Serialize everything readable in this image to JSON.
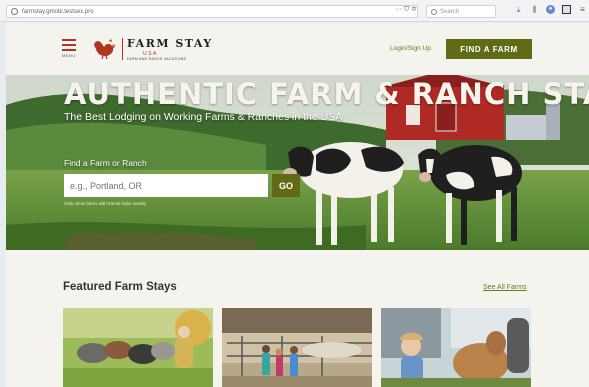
{
  "browser": {
    "url": "farmstay.gmobi.testsex.pro",
    "actions": "··· ⛉ ☆",
    "search_placeholder": "Search",
    "toolbar_icons": [
      "download-icon",
      "library-icon",
      "account-icon",
      "sidebar-icon",
      "overflow-icon"
    ]
  },
  "header": {
    "menu_label": "MENU",
    "logo_title": "FARM STAY",
    "logo_sub": "USA",
    "logo_tagline": "FARM AND RANCH VACATIONS",
    "login_label": "Login/Sign Up",
    "cta_label": "FIND A FARM"
  },
  "hero": {
    "title": "AUTHENTIC FARM & RANCH STAYS",
    "subtitle": "The Best Lodging on Working Farms & Ranches in the USA",
    "find_label": "Find a Farm or Ranch",
    "search_placeholder": "e.g., Portland, OR",
    "go_label": "GO",
    "geo_hint": "Only show farms with transit hubs nearby"
  },
  "featured": {
    "title": "Featured Farm Stays",
    "see_all": "See All Farms",
    "cards": [
      {
        "name": "farm-card-sheep"
      },
      {
        "name": "farm-card-goats"
      },
      {
        "name": "farm-card-calf"
      }
    ]
  },
  "colors": {
    "accent": "#616b16",
    "brand_red": "#b2331f",
    "page_bg": "#f5f3ee"
  }
}
